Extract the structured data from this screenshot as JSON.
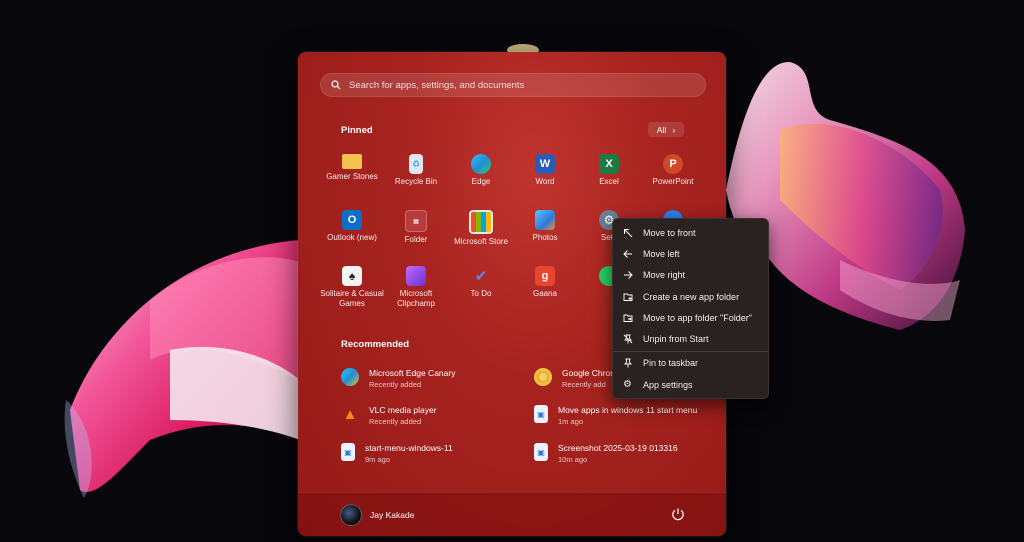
{
  "search": {
    "placeholder": "Search for apps, settings, and documents"
  },
  "pinned": {
    "title": "Pinned",
    "all_label": "All",
    "apps": [
      {
        "label": "Gamer Stones",
        "icon": "folder-icon",
        "color": "#f2c14e"
      },
      {
        "label": "Recycle Bin",
        "icon": "recycle-bin-icon",
        "color": "#dfe8f0"
      },
      {
        "label": "Edge",
        "icon": "edge-icon",
        "color": "#1f8fd6"
      },
      {
        "label": "Word",
        "icon": "word-icon",
        "color": "#2b5bb5"
      },
      {
        "label": "Excel",
        "icon": "excel-icon",
        "color": "#1e7a44"
      },
      {
        "label": "PowerPoint",
        "icon": "powerpoint-icon",
        "color": "#d24726"
      },
      {
        "label": "Outlook (new)",
        "icon": "outlook-icon",
        "color": "#0b6fc6"
      },
      {
        "label": "Folder",
        "icon": "app-folder-icon",
        "color": "#b83b3b"
      },
      {
        "label": "Microsoft Store",
        "icon": "store-icon",
        "color": "#e8e8e8"
      },
      {
        "label": "Photos",
        "icon": "photos-icon",
        "color": "#2f79d8"
      },
      {
        "label": "Setti",
        "icon": "settings-icon",
        "color": "#6b7f96"
      },
      {
        "label": "",
        "icon": "chrome-icon",
        "color": "#2b7ff0"
      },
      {
        "label": "Solitaire & Casual Games",
        "icon": "solitaire-icon",
        "color": "#2e3b5f"
      },
      {
        "label": "Microsoft Clipchamp",
        "icon": "clipchamp-icon",
        "color": "#8a4ad8"
      },
      {
        "label": "To Do",
        "icon": "todo-icon",
        "color": "#3f7de8"
      },
      {
        "label": "Gaana",
        "icon": "gaana-icon",
        "color": "#e8452c"
      },
      {
        "label": "",
        "icon": "whatsapp-icon",
        "color": "#25d366"
      }
    ]
  },
  "recommended": {
    "title": "Recommended",
    "items": [
      {
        "title": "Microsoft Edge Canary",
        "subtitle": "Recently added",
        "icon": "edge-canary-icon"
      },
      {
        "title": "Google Chrom",
        "subtitle": "Recently add",
        "icon": "chrome-canary-icon"
      },
      {
        "title": "VLC media player",
        "subtitle": "Recently added",
        "icon": "vlc-icon"
      },
      {
        "title": "Move apps in windows 11 start menu",
        "subtitle": "1m ago",
        "icon": "image-file-icon"
      },
      {
        "title": "start-menu-windows-11",
        "subtitle": "9m ago",
        "icon": "image-file-icon"
      },
      {
        "title": "Screenshot 2025-03-19 013316",
        "subtitle": "10m ago",
        "icon": "image-file-icon"
      }
    ]
  },
  "user": {
    "name": "Jay Kakade"
  },
  "context_menu": {
    "items": [
      {
        "label": "Move to front",
        "icon": "arrow-up-left-icon"
      },
      {
        "label": "Move left",
        "icon": "arrow-left-icon"
      },
      {
        "label": "Move right",
        "icon": "arrow-right-icon"
      },
      {
        "label": "Create a new app folder",
        "icon": "folder-add-icon"
      },
      {
        "label": "Move to app folder \"Folder\"",
        "icon": "folder-move-icon"
      },
      {
        "label": "Unpin from Start",
        "icon": "unpin-icon"
      },
      {
        "label": "Pin to taskbar",
        "icon": "pin-icon"
      },
      {
        "label": "App settings",
        "icon": "gear-icon"
      }
    ]
  },
  "colors": {
    "accent": "#a7231f",
    "menu_bg": "#2a2220"
  }
}
